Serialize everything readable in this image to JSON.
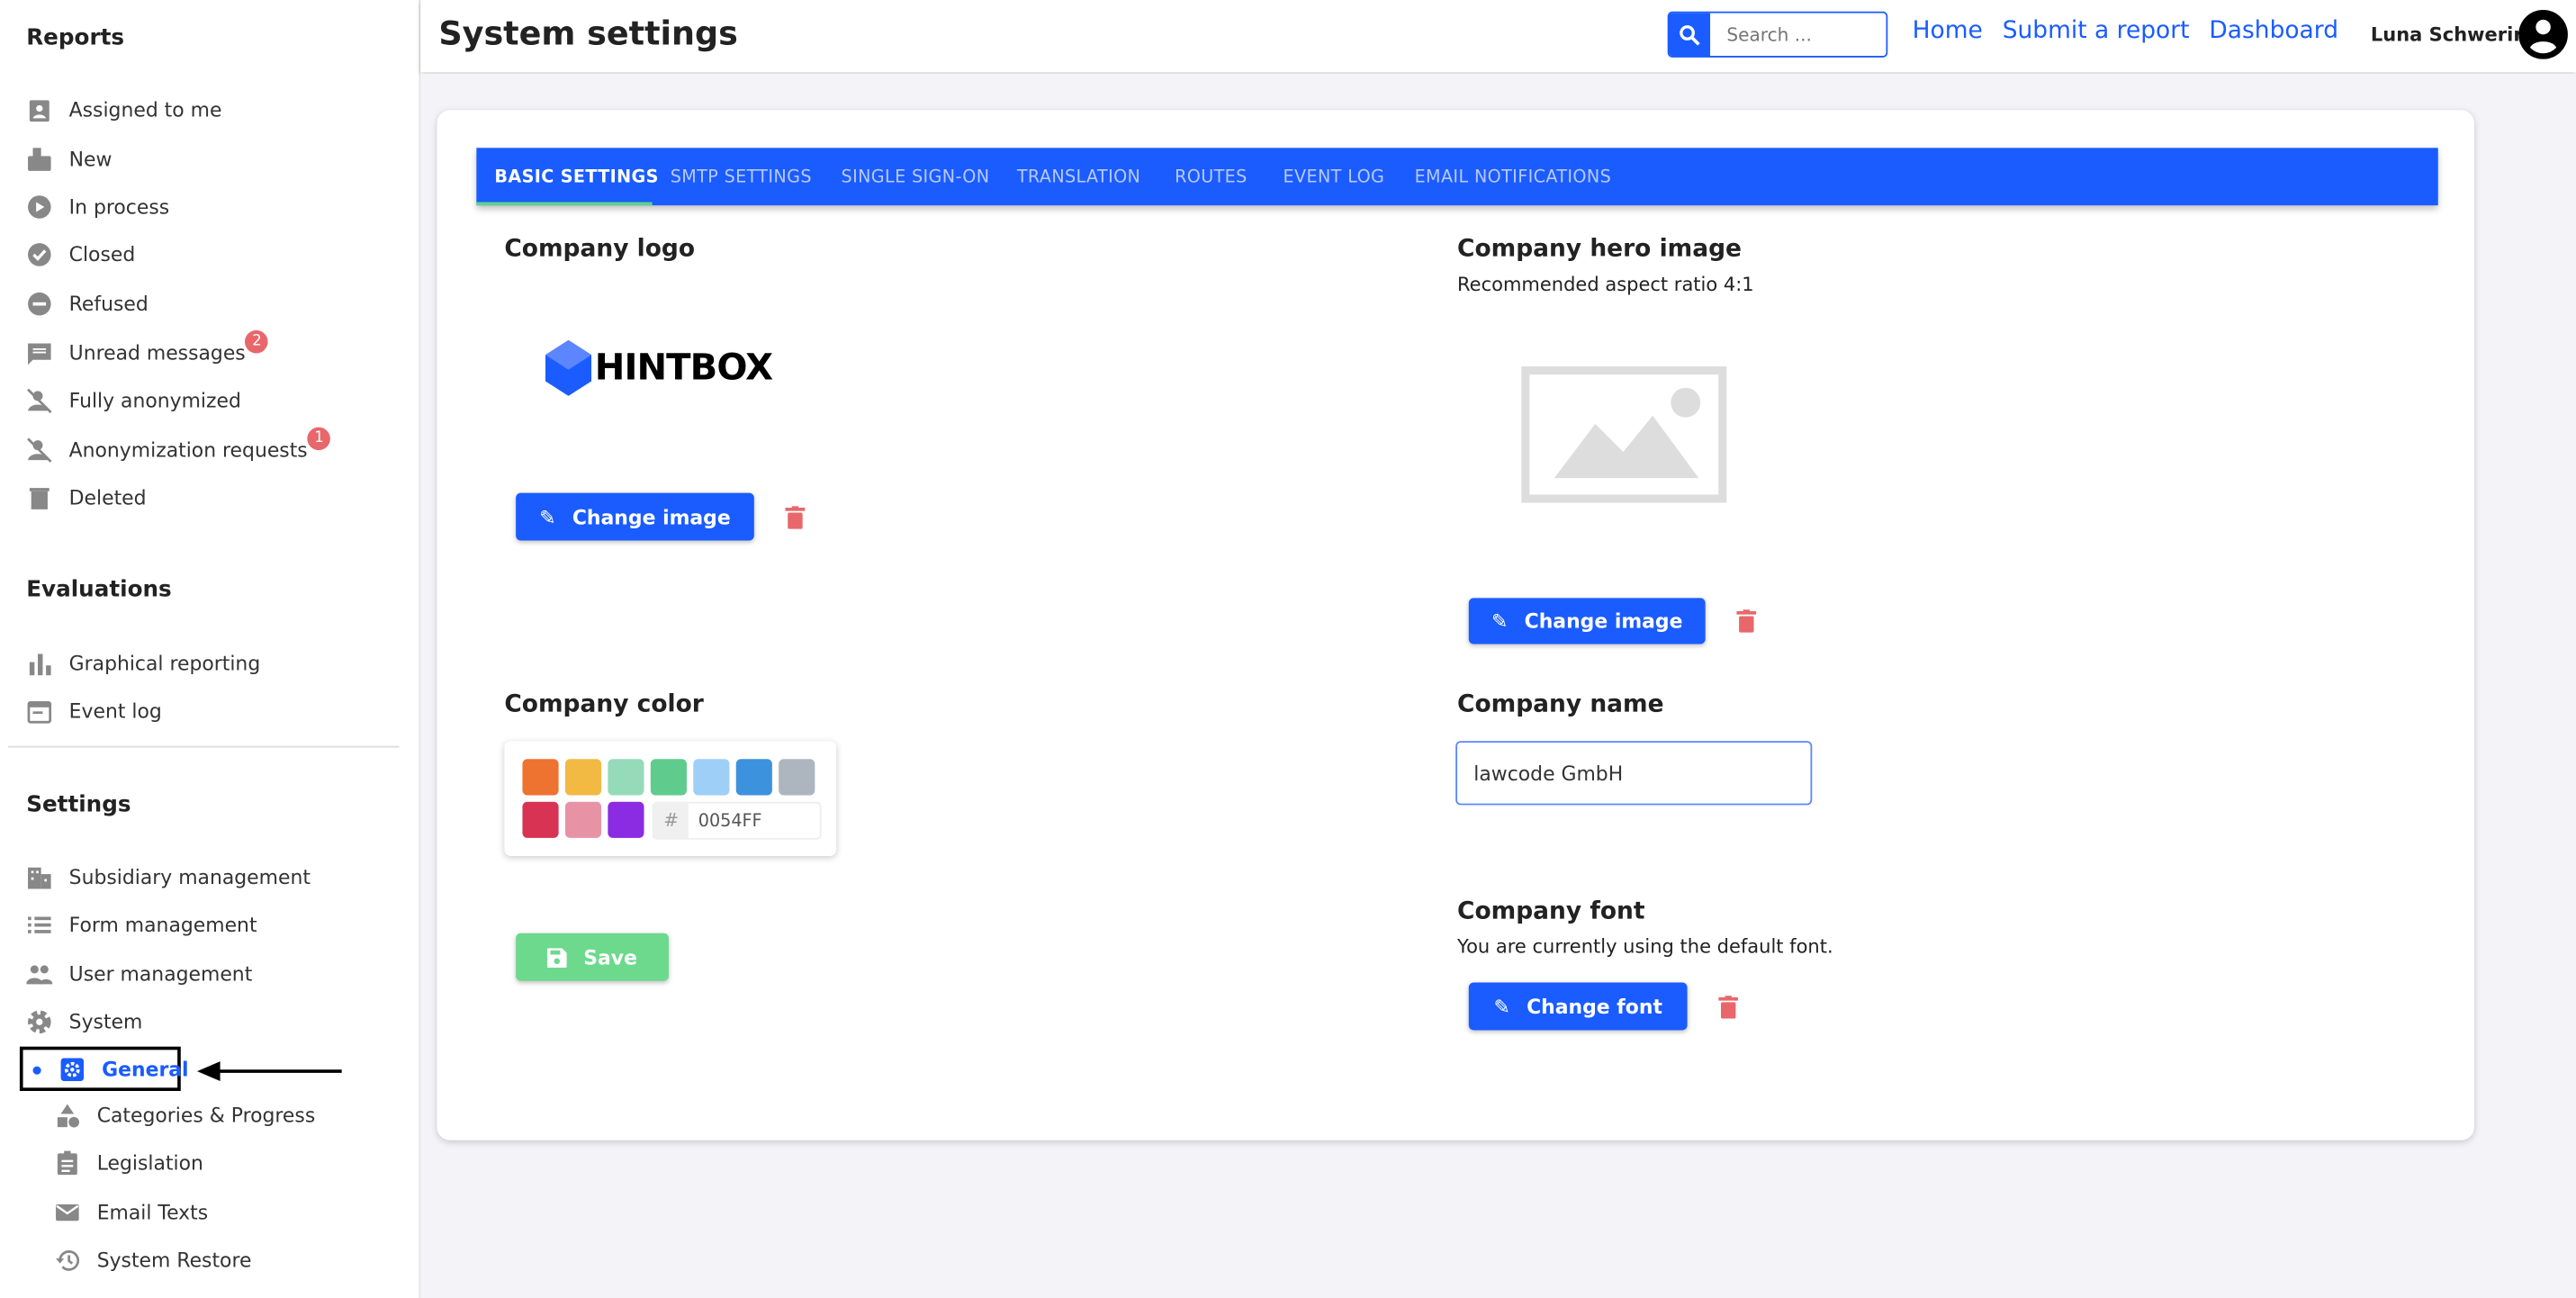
{
  "sidebar": {
    "reports_heading": "Reports",
    "reports": [
      {
        "label": "Assigned to me",
        "icon": "assignment-ind-icon"
      },
      {
        "label": "New",
        "icon": "mailbox-icon"
      },
      {
        "label": "In process",
        "icon": "play-circle-icon"
      },
      {
        "label": "Closed",
        "icon": "check-circle-icon"
      },
      {
        "label": "Refused",
        "icon": "minus-circle-icon"
      },
      {
        "label": "Unread messages",
        "icon": "message-icon",
        "badge": "2"
      },
      {
        "label": "Fully anonymized",
        "icon": "person-off-icon"
      },
      {
        "label": "Anonymization requests",
        "icon": "person-off-icon",
        "badge": "1"
      },
      {
        "label": "Deleted",
        "icon": "trash-icon"
      }
    ],
    "evaluations_heading": "Evaluations",
    "evaluations": [
      {
        "label": "Graphical reporting",
        "icon": "bar-chart-icon"
      },
      {
        "label": "Event log",
        "icon": "calendar-icon"
      }
    ],
    "settings_heading": "Settings",
    "settings": [
      {
        "label": "Subsidiary management",
        "icon": "building-icon"
      },
      {
        "label": "Form management",
        "icon": "list-icon"
      },
      {
        "label": "User management",
        "icon": "people-icon"
      },
      {
        "label": "System",
        "icon": "gear-icon"
      }
    ],
    "active": {
      "label": "General",
      "icon": "settings-box-icon"
    },
    "system_sub": [
      {
        "label": "Categories & Progress",
        "icon": "shapes-icon"
      },
      {
        "label": "Legislation",
        "icon": "clipboard-icon"
      },
      {
        "label": "Email Texts",
        "icon": "mail-icon"
      },
      {
        "label": "System Restore",
        "icon": "history-icon"
      }
    ]
  },
  "header": {
    "title": "System settings",
    "search_placeholder": "Search ...",
    "links": [
      "Home",
      "Submit a report",
      "Dashboard"
    ],
    "user": "Luna Schwerin"
  },
  "tabs": [
    "BASIC SETTINGS",
    "SMTP SETTINGS",
    "SINGLE SIGN-ON",
    "TRANSLATION",
    "ROUTES",
    "EVENT LOG",
    "EMAIL NOTIFICATIONS"
  ],
  "active_tab": "BASIC SETTINGS",
  "content": {
    "logo_heading": "Company logo",
    "logo_text": "HINTBOX",
    "change_image": "Change image",
    "hero_heading": "Company hero image",
    "hero_sub": "Recommended aspect ratio 4:1",
    "color_heading": "Company color",
    "swatches": [
      "#EE7230",
      "#F2BA43",
      "#95DBB9",
      "#5FCC8D",
      "#9ECFF7",
      "#3D92DD",
      "#ADB6BF",
      "#D83352",
      "#E893A5",
      "#8B2BE2"
    ],
    "hash": "#",
    "hex_value": "0054FF",
    "save": "Save",
    "name_heading": "Company name",
    "name_value": "lawcode GmbH",
    "font_heading": "Company font",
    "font_sub": "You are currently using the default font.",
    "change_font": "Change font"
  },
  "colors": {
    "primary": "#1A5CFF",
    "success": "#6CD98C",
    "danger": "#E8676B",
    "tab_indicator": "#5FD38D"
  }
}
